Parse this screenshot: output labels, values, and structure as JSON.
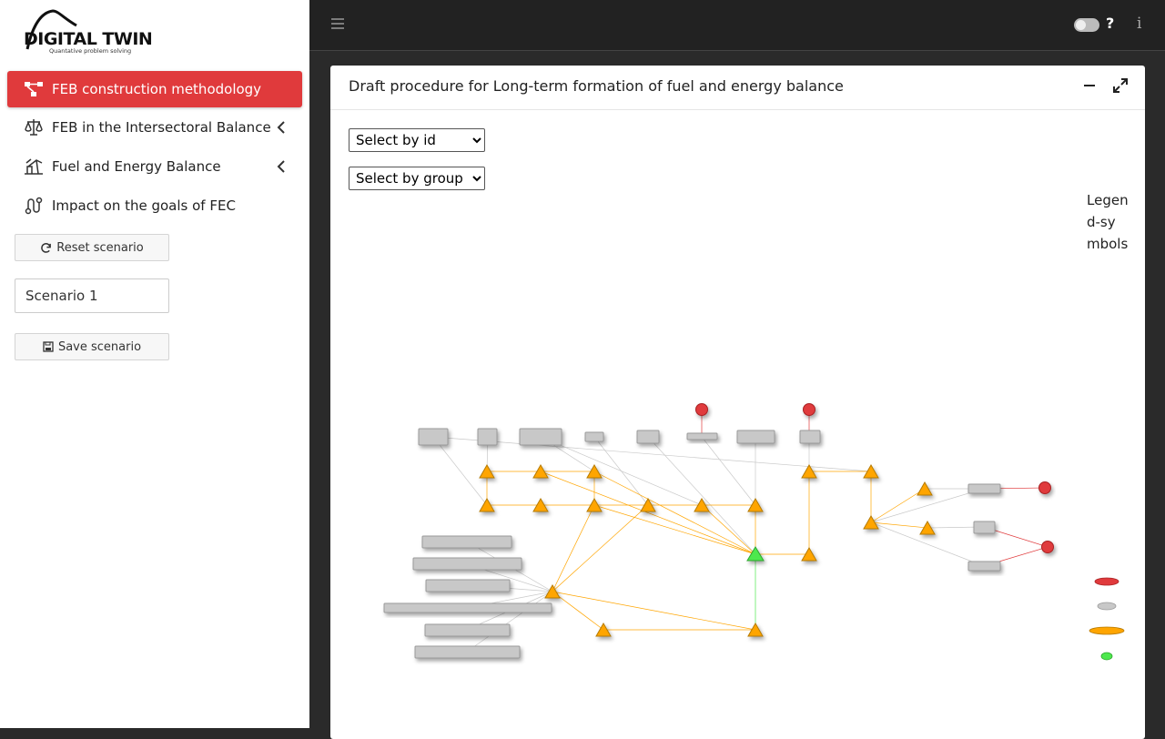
{
  "sidebar": {
    "logo_title": "DIGITAL TWIN",
    "logo_subtitle": "Quantative problem solving",
    "items": [
      {
        "label": "FEB construction methodology",
        "icon": "network-icon"
      },
      {
        "label": "FEB in the Intersectoral Balance",
        "icon": "balance-scale-icon"
      },
      {
        "label": "Fuel and Energy Balance",
        "icon": "oil-pump-icon"
      },
      {
        "label": "Impact on the goals of FEC",
        "icon": "route-icon"
      }
    ],
    "reset_label": "Reset scenario",
    "scenario_value": "Scenario 1",
    "save_label": "Save scenario"
  },
  "topbar": {
    "help": "?",
    "info": "i"
  },
  "card": {
    "title": "Draft procedure for Long-term formation of fuel and energy balance",
    "select_id": {
      "options": [
        "Select by id"
      ]
    },
    "select_group": {
      "options": [
        "Select by group"
      ]
    },
    "legend_title": "Legend-symbols",
    "legend_colors": [
      "#e03a3c",
      "#c8c8c8",
      "#ffa500",
      "#4ee84e"
    ]
  },
  "colors": {
    "accent": "#e03a3c",
    "node_gray": "#c8c8c8",
    "node_orange": "#ffa500",
    "node_green": "#4ee84e",
    "node_red": "#e03a3c"
  }
}
